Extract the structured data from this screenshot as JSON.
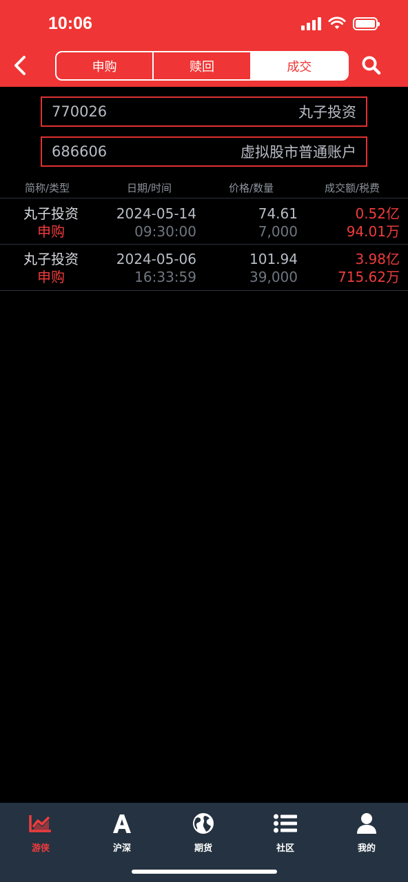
{
  "status_bar": {
    "time": "10:06"
  },
  "header": {
    "tabs": [
      {
        "label": "申购"
      },
      {
        "label": "赎回"
      },
      {
        "label": "成交"
      }
    ]
  },
  "accounts": [
    {
      "id": "770026",
      "name": "丸子投资"
    },
    {
      "id": "686606",
      "name": "虚拟股市普通账户"
    }
  ],
  "table": {
    "headers": [
      "简称/类型",
      "日期/时间",
      "价格/数量",
      "成交额/税费"
    ],
    "rows": [
      {
        "name": "丸子投资",
        "type": "申购",
        "date": "2024-05-14",
        "time": "09:30:00",
        "price": "74.61",
        "qty": "7,000",
        "amount": "0.52亿",
        "fee": "94.01万"
      },
      {
        "name": "丸子投资",
        "type": "申购",
        "date": "2024-05-06",
        "time": "16:33:59",
        "price": "101.94",
        "qty": "39,000",
        "amount": "3.98亿",
        "fee": "715.62万"
      }
    ]
  },
  "tabbar": {
    "items": [
      {
        "label": "游侠",
        "icon": "chart-trend-icon"
      },
      {
        "label": "沪深",
        "icon": "letter-a-icon"
      },
      {
        "label": "期货",
        "icon": "globe-icon"
      },
      {
        "label": "社区",
        "icon": "list-icon"
      },
      {
        "label": "我的",
        "icon": "user-icon"
      }
    ]
  },
  "colors": {
    "brand": "#ef3535",
    "tabbar": "#243241",
    "background": "#000000"
  }
}
